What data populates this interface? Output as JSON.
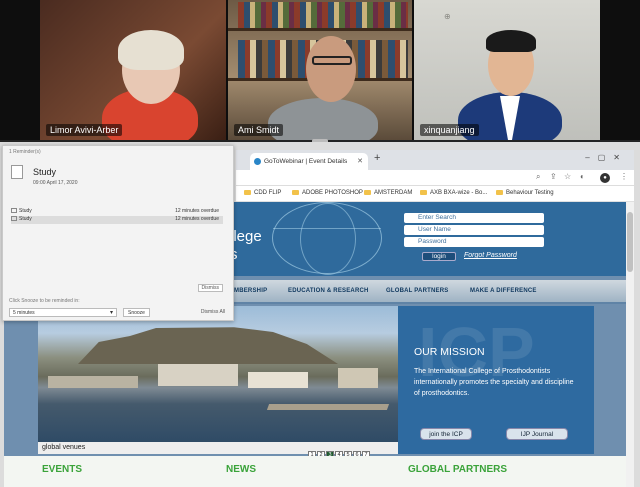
{
  "participants": [
    {
      "name": "Limor Avivi-Arber"
    },
    {
      "name": "Ami Smidt"
    },
    {
      "name": "xinquanjiang"
    }
  ],
  "browser": {
    "tab_title": "GoToWebinar | Event Details",
    "new_tab": "+",
    "bookmarks": [
      "CDD FLIP",
      "ADOBE PHOTOSHOP",
      "AMSTERDAM",
      "AXB BXA-wize - Bo...",
      "Behaviour Testing"
    ]
  },
  "site": {
    "college_line1": "llege",
    "college_line2": "s",
    "login": {
      "search_placeholder": "Enter Search",
      "user_placeholder": "User Name",
      "password_placeholder": "Password",
      "login_button": "login",
      "forgot_link": "Forgot Password"
    },
    "nav": [
      "MBERSHIP",
      "EDUCATION & RESEARCH",
      "GLOBAL PARTNERS",
      "MAKE A DIFFERENCE"
    ],
    "slideshow": {
      "caption": "global venues",
      "pages": [
        "1",
        "2",
        "3",
        "4",
        "5",
        "6",
        "7"
      ],
      "active_page": 3
    },
    "mission": {
      "heading": "OUR MISSION",
      "text": "The International College of Prosthodontists internationally promotes the specialty and discipline of prosthodontics.",
      "button1": "join the ICP",
      "button2": "IJP Journal"
    },
    "footer": [
      "EVENTS",
      "NEWS",
      "GLOBAL PARTNERS"
    ]
  },
  "recorder_panel": {
    "title": "1 Reminder(s)",
    "doc_name": "Study",
    "doc_date": "09:00 April 17, 2020",
    "rows": [
      {
        "label": "Study",
        "duration": "12 minutes overdue"
      },
      {
        "label": "Study",
        "duration": "12 minutes overdue"
      }
    ],
    "dismiss_button": "Dismiss",
    "snooze_label": "Click Snooze to be reminded in:",
    "snooze_value": "5 minutes",
    "snooze_button": "Snooze",
    "dismiss_all": "Dismiss All"
  },
  "colors": {
    "site_blue": "#2f6a9c",
    "footer_green": "#3aa33a",
    "active_page": "#1e5a2f"
  }
}
